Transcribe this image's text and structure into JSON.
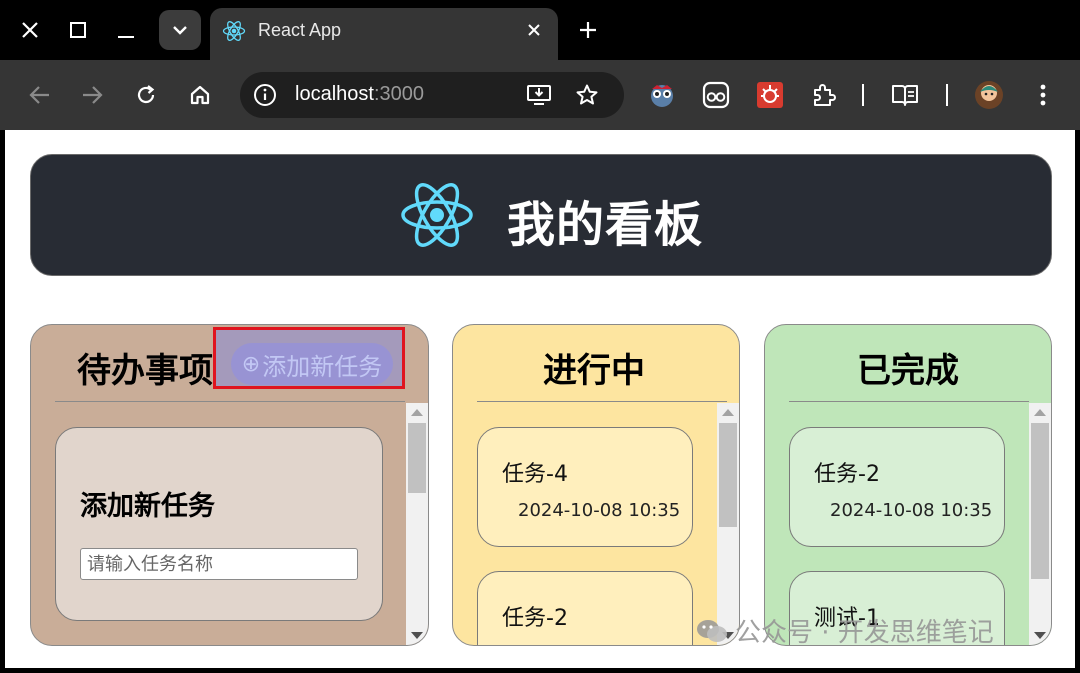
{
  "browser": {
    "tab_title": "React App",
    "url_host": "localhost",
    "url_port": ":3000"
  },
  "header": {
    "title": "我的看板"
  },
  "columns": {
    "todo": {
      "title": "待办事项",
      "add_button": "添加新任务",
      "form": {
        "title": "添加新任务",
        "placeholder": "请输入任务名称"
      }
    },
    "in_progress": {
      "title": "进行中",
      "tasks": [
        {
          "name": "任务-4",
          "time": "2024-10-08 10:35"
        },
        {
          "name": "任务-2",
          "time": ""
        }
      ]
    },
    "done": {
      "title": "已完成",
      "tasks": [
        {
          "name": "任务-2",
          "time": "2024-10-08 10:35"
        },
        {
          "name": "测试-1",
          "time": ""
        }
      ]
    }
  },
  "watermark": "公众号 · 开发思维笔记",
  "colors": {
    "header_bg": "#282c34",
    "react_blue": "#61dafb",
    "todo_bg": "#c9ad98",
    "progress_bg": "#fde5a0",
    "done_bg": "#bfe6b9",
    "highlight": "#e0141e"
  }
}
